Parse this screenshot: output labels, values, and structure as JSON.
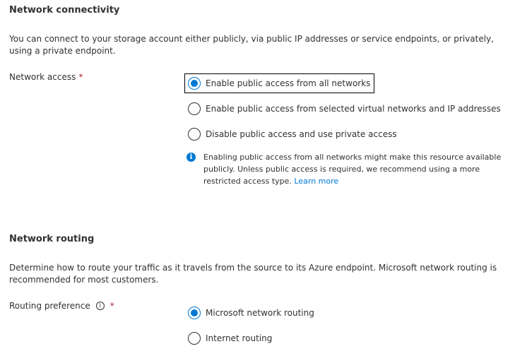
{
  "network_connectivity": {
    "heading": "Network connectivity",
    "description": "You can connect to your storage account either publicly, via public IP addresses or service endpoints, or privately, using a private endpoint.",
    "network_access": {
      "label": "Network access",
      "required_marker": "*",
      "options": [
        {
          "label": "Enable public access from all networks",
          "checked": true
        },
        {
          "label": "Enable public access from selected virtual networks and IP addresses",
          "checked": false
        },
        {
          "label": "Disable public access and use private access",
          "checked": false
        }
      ],
      "info": {
        "icon": "info-icon",
        "text": "Enabling public access from all networks might make this resource available publicly. Unless public access is required, we recommend using a more restricted access type.",
        "link": "Learn more"
      }
    }
  },
  "network_routing": {
    "heading": "Network routing",
    "description": "Determine how to route your traffic as it travels from the source to its Azure endpoint. Microsoft network routing is recommended for most customers.",
    "routing_preference": {
      "label": "Routing preference",
      "tooltip_icon": "info-circle-icon",
      "required_marker": "*",
      "options": [
        {
          "label": "Microsoft network routing",
          "checked": true
        },
        {
          "label": "Internet routing",
          "checked": false
        }
      ]
    }
  },
  "colors": {
    "accent": "#0078d4",
    "text": "#323130",
    "required": "#a4262c"
  }
}
